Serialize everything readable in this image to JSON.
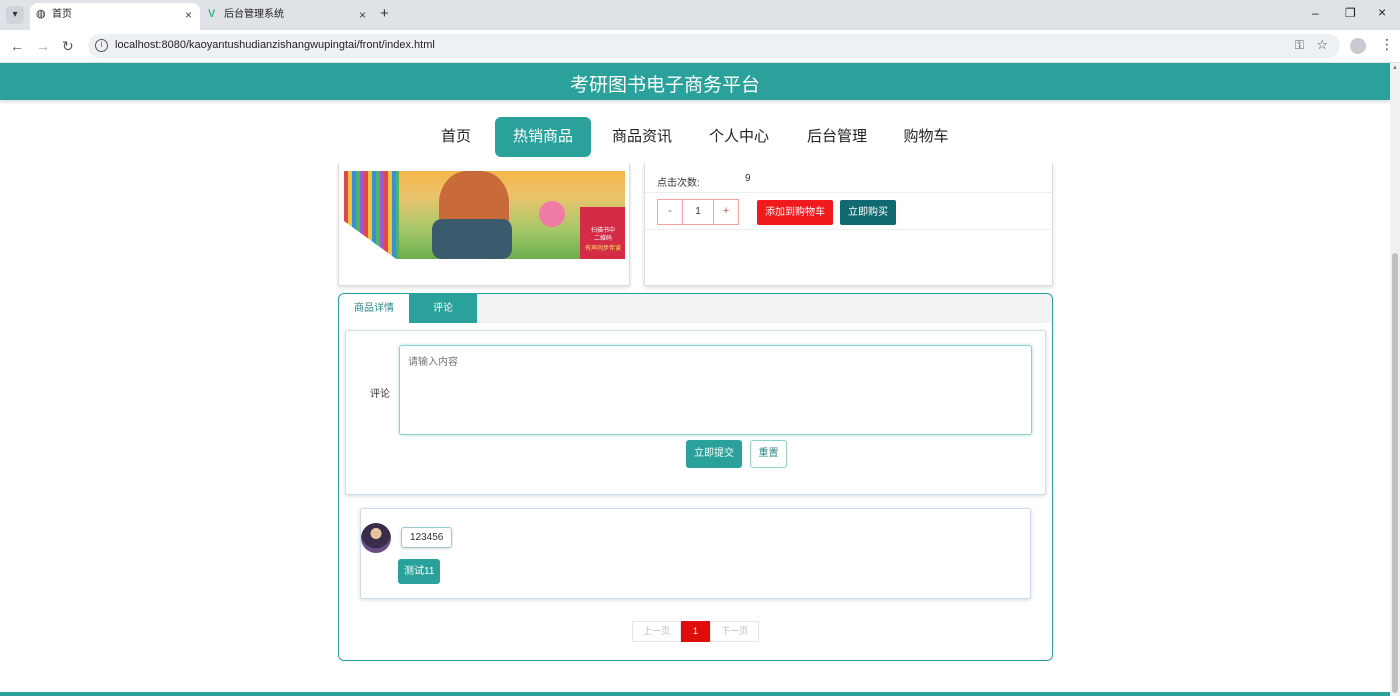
{
  "browser": {
    "tabs": [
      {
        "title": "首页",
        "active": true
      },
      {
        "title": "后台管理系统",
        "active": false
      }
    ],
    "url": "localhost:8080/kaoyantushudianzishangwupingtai/front/index.html",
    "icons": {
      "tab_menu": "▾",
      "close": "×",
      "new_tab": "+",
      "minimize": "–",
      "restore": "❐",
      "back": "←",
      "forward": "→",
      "reload": "↻",
      "info": "i",
      "key": "⚿",
      "star": "☆",
      "kebab": "⋮"
    }
  },
  "site": {
    "title": "考研图书电子商务平台",
    "accent": "#2aa19b",
    "nav": [
      "首页",
      "热销商品",
      "商品资讯",
      "个人中心",
      "后台管理",
      "购物车"
    ],
    "nav_active": "热销商品"
  },
  "product": {
    "cover": {
      "line1": "扫描书中",
      "line2": "二维码",
      "line3": "有声同步伴读"
    },
    "clicks_label": "点击次数:",
    "clicks_value": "9",
    "quantity": "1",
    "minus": "-",
    "plus": "+",
    "add_to_cart": "添加到购物车",
    "buy_now": "立即购买"
  },
  "tabs": {
    "detail": "商品详情",
    "comment": "评论",
    "active": "评论"
  },
  "comment_form": {
    "label": "评论",
    "placeholder": "请输入内容",
    "submit": "立即提交",
    "reset": "重置"
  },
  "comments": [
    {
      "user": "123456",
      "text": "测试11"
    }
  ],
  "pager": {
    "prev": "上一页",
    "current": "1",
    "next": "下一页"
  }
}
